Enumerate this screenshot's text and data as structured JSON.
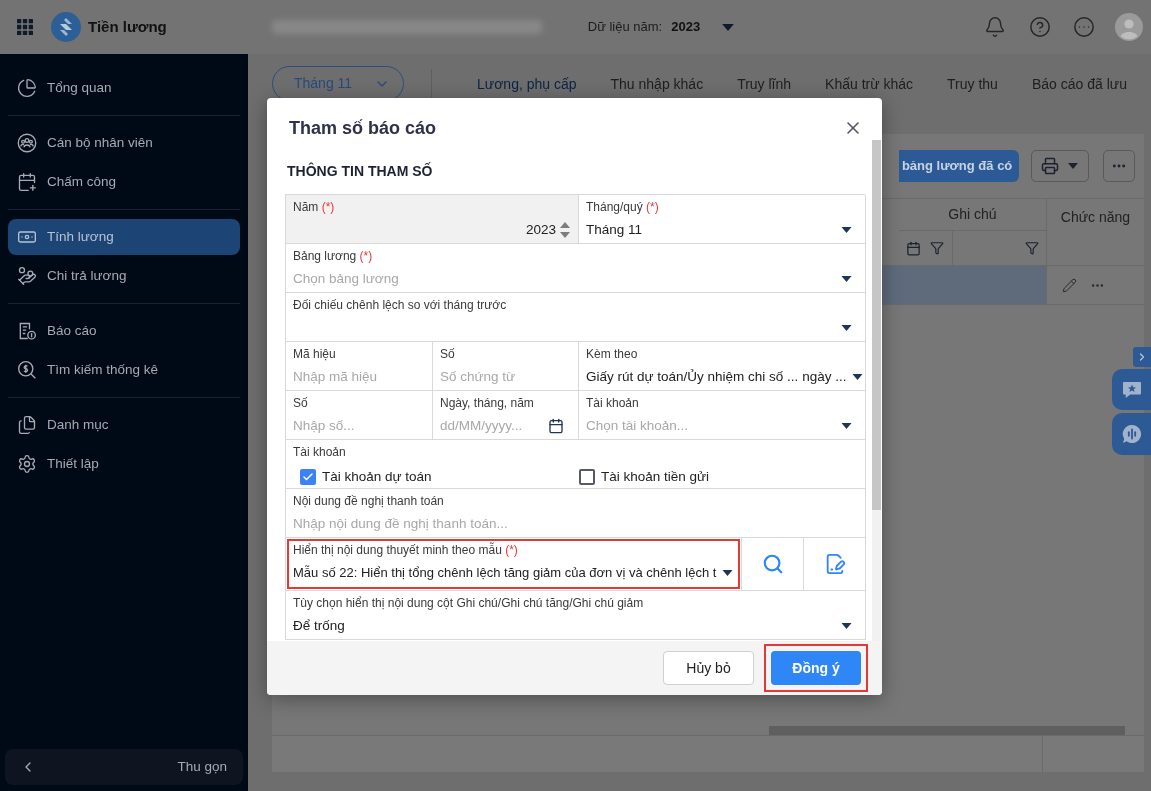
{
  "topbar": {
    "app_name": "Tiền lương",
    "year_label": "Dữ liệu năm:",
    "year": "2023"
  },
  "sidebar": {
    "sections": [
      {
        "items": [
          {
            "label": "Tổng quan",
            "selected": false
          }
        ]
      },
      {
        "items": [
          {
            "label": "Cán bộ nhân viên",
            "selected": false
          },
          {
            "label": "Chấm công",
            "selected": false
          }
        ]
      },
      {
        "items": [
          {
            "label": "Tính lương",
            "selected": true
          },
          {
            "label": "Chi trả lương",
            "selected": false
          }
        ]
      },
      {
        "items": [
          {
            "label": "Báo cáo",
            "selected": false
          },
          {
            "label": "Tìm kiếm thống kê",
            "selected": false
          }
        ]
      },
      {
        "items": [
          {
            "label": "Danh mục",
            "selected": false
          },
          {
            "label": "Thiết lập",
            "selected": false
          }
        ]
      }
    ],
    "collapse_button": "Thu gọn"
  },
  "main": {
    "period_picker": "Tháng 11",
    "tabs": [
      {
        "label": "Lương, phụ cấp",
        "selected": true
      },
      {
        "label": "Thu nhập khác",
        "selected": false
      },
      {
        "label": "Truy lĩnh",
        "selected": false
      },
      {
        "label": "Khấu trừ khác",
        "selected": false
      },
      {
        "label": "Truy thu",
        "selected": false
      },
      {
        "label": "Báo cáo đã lưu",
        "selected": false
      }
    ],
    "toolbar": {
      "primary_button": "bảng lương đã có"
    },
    "table": {
      "columns": [
        "Ghi chú",
        "Chức năng"
      ],
      "rows": [
        {
          "selected": true
        }
      ]
    }
  },
  "dialog": {
    "title": "Tham số báo cáo",
    "section_title": "THÔNG TIN THAM SỐ",
    "form": {
      "rows": [
        {
          "cells": [
            {
              "kind": "number",
              "label": "Năm",
              "required_mark": "(*)",
              "value": "2023",
              "disabled": true,
              "colspan": 2
            },
            {
              "kind": "select",
              "label": "Tháng/quý",
              "required_mark": "(*)",
              "value": "Tháng 11",
              "colspan": 3
            }
          ]
        },
        {
          "cells": [
            {
              "kind": "select",
              "label": "Bảng lương",
              "required_mark": "(*)",
              "placeholder": "Chọn bảng lương",
              "colspan": 5
            }
          ]
        },
        {
          "cells": [
            {
              "kind": "select",
              "label": "Đối chiếu chênh lệch so với tháng trước",
              "colspan": 5
            }
          ]
        },
        {
          "cells": [
            {
              "kind": "text",
              "label": "Mã hiệu",
              "placeholder": "Nhập mã hiệu"
            },
            {
              "kind": "text",
              "label": "Số",
              "placeholder": "Số chứng từ"
            },
            {
              "kind": "select",
              "label": "Kèm theo",
              "value": "Giấy rút dự toán/Ủy nhiệm chi số ... ngày ...",
              "colspan": 3
            }
          ]
        },
        {
          "cells": [
            {
              "kind": "text",
              "label": "Số",
              "placeholder": "Nhập số..."
            },
            {
              "kind": "date",
              "label": "Ngày, tháng, năm",
              "placeholder": "dd/MM/yyyy..."
            },
            {
              "kind": "select",
              "label": "Tài khoản",
              "placeholder": "Chọn tài khoản...",
              "colspan": 3
            }
          ]
        },
        {
          "cells": [
            {
              "kind": "checkboxes",
              "label": "Tài khoản",
              "options": [
                {
                  "label": "Tài khoản dự toán",
                  "checked": true
                },
                {
                  "label": "Tài khoản tiền gửi",
                  "checked": false
                }
              ],
              "colspan": 5
            }
          ]
        },
        {
          "cells": [
            {
              "kind": "text",
              "label": "Nội dung đề nghị thanh toán",
              "placeholder": "Nhập nội dung đề nghị thanh toán...",
              "colspan": 5
            }
          ]
        },
        {
          "cells": [
            {
              "kind": "select",
              "label": "Hiển thị nội dung thuyết minh theo mẫu",
              "required_mark": "(*)",
              "value": "Mẫu số 22: Hiển thị tổng chênh lệch tăng giảm của đơn vị và chênh lệch t",
              "highlighted": true,
              "colspan": 3
            },
            {
              "kind": "search"
            },
            {
              "kind": "edit"
            }
          ]
        },
        {
          "cells": [
            {
              "kind": "select",
              "label": "Tùy chọn hiển thị nội dung cột Ghi chú/Ghi chú tăng/Ghi chú giảm",
              "value": "Để trống",
              "colspan": 5
            }
          ]
        }
      ]
    },
    "buttons": [
      {
        "label": "Hủy bỏ",
        "kind": "secondary",
        "highlighted": false
      },
      {
        "label": "Đồng ý",
        "kind": "primary",
        "highlighted": true
      }
    ]
  }
}
